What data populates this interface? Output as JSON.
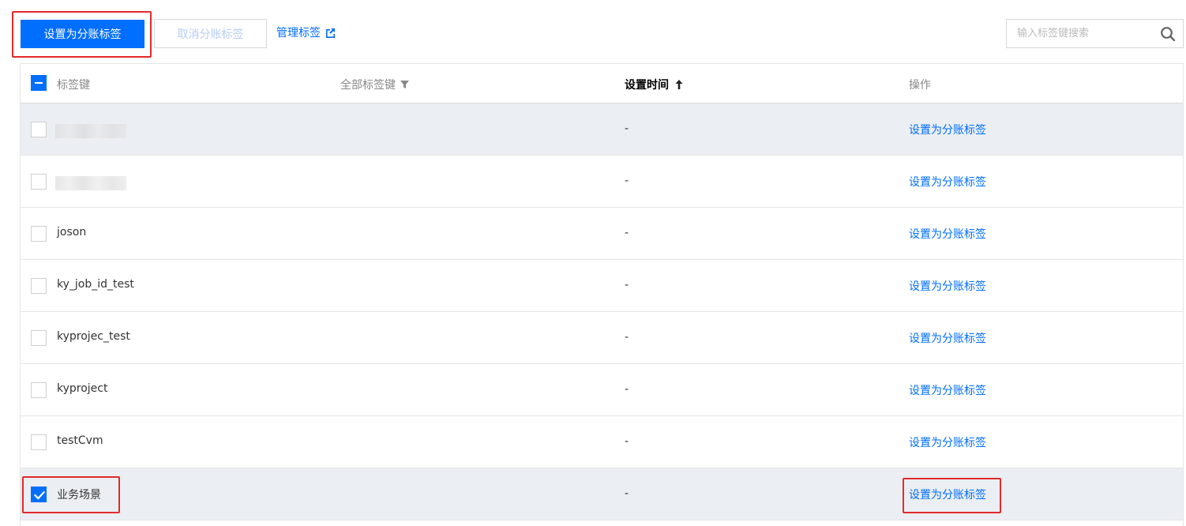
{
  "toolbar": {
    "set_button_label": "设置为分账标签",
    "cancel_button_label": "取消分账标签",
    "manage_link_label": "管理标签"
  },
  "search": {
    "placeholder": "输入标签键搜索",
    "value": ""
  },
  "table": {
    "columns": {
      "key": "标签键",
      "all_keys": "全部标签键",
      "set_time": "设置时间",
      "operation": "操作"
    },
    "rows": [
      {
        "key": "",
        "redacted": true,
        "time": "-",
        "op": "设置为分账标签",
        "checked": false
      },
      {
        "key": "",
        "redacted": true,
        "time": "-",
        "op": "设置为分账标签",
        "checked": false
      },
      {
        "key": "joson",
        "time": "-",
        "op": "设置为分账标签",
        "checked": false
      },
      {
        "key": "ky_job_id_test",
        "time": "-",
        "op": "设置为分账标签",
        "checked": false
      },
      {
        "key": "kyprojec_test",
        "time": "-",
        "op": "设置为分账标签",
        "checked": false
      },
      {
        "key": "kyproject",
        "time": "-",
        "op": "设置为分账标签",
        "checked": false
      },
      {
        "key": "testCvm",
        "time": "-",
        "op": "设置为分账标签",
        "checked": false
      },
      {
        "key": "业务场景",
        "time": "-",
        "op": "设置为分账标签",
        "checked": true
      }
    ]
  },
  "colors": {
    "primary": "#006eff",
    "annotation_red": "#e22a2a",
    "row_highlight": "#ebeef2"
  }
}
